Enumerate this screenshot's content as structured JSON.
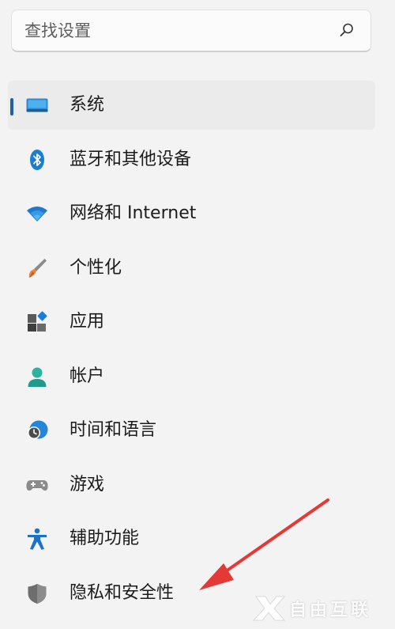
{
  "search": {
    "placeholder": "查找设置",
    "value": ""
  },
  "sidebar": {
    "items": [
      {
        "label": "系统",
        "icon": "system-icon",
        "selected": true
      },
      {
        "label": "蓝牙和其他设备",
        "icon": "bluetooth-icon",
        "selected": false
      },
      {
        "label": "网络和 Internet",
        "icon": "wifi-icon",
        "selected": false
      },
      {
        "label": "个性化",
        "icon": "brush-icon",
        "selected": false
      },
      {
        "label": "应用",
        "icon": "apps-icon",
        "selected": false
      },
      {
        "label": "帐户",
        "icon": "account-icon",
        "selected": false
      },
      {
        "label": "时间和语言",
        "icon": "time-language-icon",
        "selected": false
      },
      {
        "label": "游戏",
        "icon": "gamepad-icon",
        "selected": false
      },
      {
        "label": "辅助功能",
        "icon": "accessibility-icon",
        "selected": false
      },
      {
        "label": "隐私和安全性",
        "icon": "shield-icon",
        "selected": false
      }
    ]
  },
  "watermark": {
    "text": "自由互联"
  },
  "colors": {
    "background": "#f3f3f3",
    "accent": "#1f5fa8",
    "selected_item": "#ebebeb",
    "annotation_arrow": "#e53935"
  }
}
